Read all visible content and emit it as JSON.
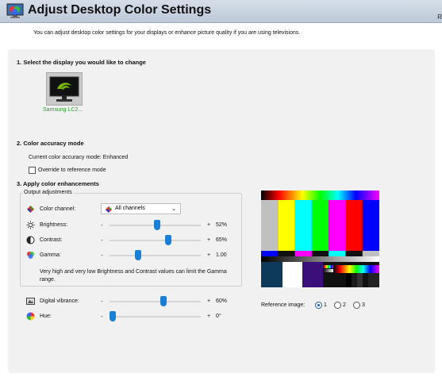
{
  "header": {
    "title": "Adjust Desktop Color Settings",
    "right_text": "R"
  },
  "subtitle": "You can adjust desktop color settings for your displays or enhance picture quality if you are using televisions.",
  "section1": {
    "title": "1. Select the display you would like to change",
    "display_label": "Samsung LC2..."
  },
  "section2": {
    "title": "2. Color accuracy mode",
    "current_mode": "Current color accuracy mode: Enhanced",
    "override_label": "Override to reference mode",
    "override_checked": false
  },
  "section3": {
    "title": "3. Apply color enhancements",
    "group_label": "Output adjustments",
    "channel": {
      "label": "Color channel:",
      "selected": "All channels"
    },
    "minus": "-",
    "plus": "+",
    "brightness": {
      "label": "Brightness:",
      "value": "52%",
      "level": 0.52
    },
    "contrast": {
      "label": "Contrast:",
      "value": "65%",
      "level": 0.65
    },
    "gamma": {
      "label": "Gamma:",
      "value": "1.00",
      "level": 0.3
    },
    "note": "Very high and very low Brightness and Contrast values can limit the Gamma range.",
    "vibrance": {
      "label": "Digital vibrance:",
      "value": "60%",
      "level": 0.6
    },
    "hue": {
      "label": "Hue:",
      "value": "0°",
      "level": 0.0
    }
  },
  "reference": {
    "label": "Reference image:",
    "options": [
      "1",
      "2",
      "3"
    ],
    "selected": "1"
  },
  "colors": {
    "accent": "#1a7fd6",
    "display_label": "#2a9d2a",
    "panel": "#f1f1f1"
  }
}
